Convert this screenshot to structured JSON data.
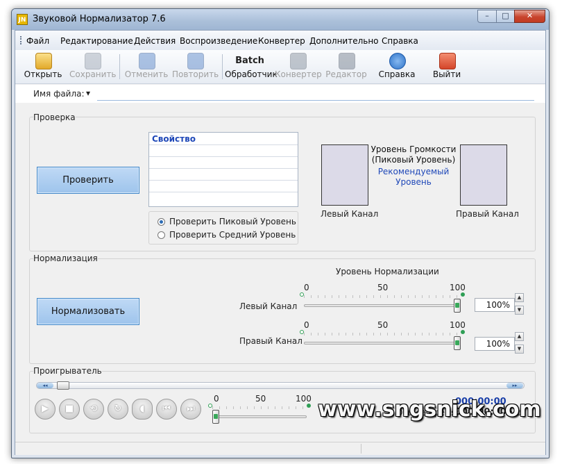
{
  "window": {
    "title": "Звуковой Нормализатор 7.6",
    "icon_text": "JN",
    "min_glyph": "–",
    "max_glyph": "□",
    "close_glyph": "✕"
  },
  "menu": [
    "Файл",
    "Редактирование",
    "Действия",
    "Воспроизведение",
    "Конвертер",
    "Дополнительно",
    "Справка"
  ],
  "toolbar": {
    "open": "Открыть",
    "save": "Сохранить",
    "undo": "Отменить",
    "redo": "Повторить",
    "batch_icon": "Batch",
    "batch": "Обработчик",
    "converter": "Конвертер",
    "editor": "Редактор",
    "help": "Справка",
    "exit": "Выйти"
  },
  "file": {
    "label": "Имя файла:",
    "dropdown": "▾",
    "value": ""
  },
  "check": {
    "title": "Проверка",
    "button": "Проверить",
    "table_header": "Свойство",
    "radio_peak": "Проверить Пиковый Уровень",
    "radio_avg": "Проверить Средний Уровень",
    "selected": "peak",
    "level_title_1": "Уровень Громкости",
    "level_title_2": "(Пиковый Уровень)",
    "recommended_1": "Рекомендуемый",
    "recommended_2": "Уровень",
    "left_channel": "Левый Канал",
    "right_channel": "Правый Канал"
  },
  "normalize": {
    "title": "Нормализация",
    "button": "Нормализовать",
    "level_title": "Уровень Нормализации",
    "scale": [
      "0",
      "50",
      "100"
    ],
    "left_label": "Левый Канал",
    "right_label": "Правый Канал",
    "left_value": "100%",
    "right_value": "100%",
    "left_level": 100,
    "right_level": 100
  },
  "player": {
    "title": "Проигрыватель",
    "seek_left": "◂◂",
    "seek_right": "▸▸",
    "volume_scale": [
      "0",
      "50",
      "100"
    ],
    "volume_level": 0,
    "current_time": "000:00:00",
    "total_label": "Общее Время:",
    "total_time": "000:00:00",
    "total_unit": "(мс)",
    "play_glyph": "▶",
    "stop_glyph": "■",
    "repeat_glyph": "↻",
    "speaker_glyph": "◖",
    "prev_glyph": "⏮",
    "next_glyph": "⏭",
    "back_glyph": "⟲"
  },
  "watermark": "www.sngsnick.com",
  "colors": {
    "accent": "#3f86c8",
    "link": "#1f48b8",
    "time": "#1a3fa8",
    "level_dot": "#2f9e55"
  }
}
